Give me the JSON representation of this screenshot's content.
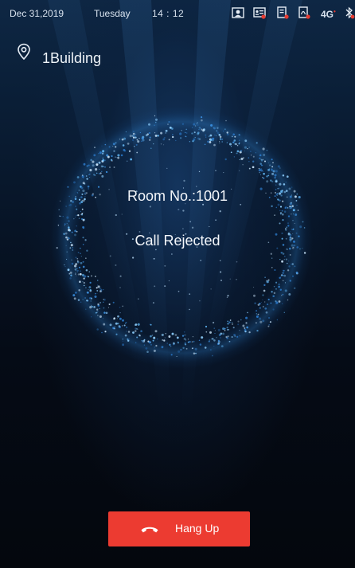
{
  "status_bar": {
    "date": "Dec 31,2019",
    "weekday": "Tuesday",
    "time": "14 : 12",
    "network": "4G",
    "icons": [
      "face-recognition-icon",
      "id-card-icon",
      "card-reader-icon",
      "fingerprint-card-icon",
      "4g-signal-icon",
      "bluetooth-icon"
    ],
    "alert_color": "#e53c32"
  },
  "location": {
    "icon": "location-pin-icon",
    "label": "1Building"
  },
  "call": {
    "room_label": "Room No.:1001",
    "status": "Call Rejected"
  },
  "hangup": {
    "icon": "phone-hangup-icon",
    "label": "Hang Up",
    "color": "#ec3b31"
  }
}
